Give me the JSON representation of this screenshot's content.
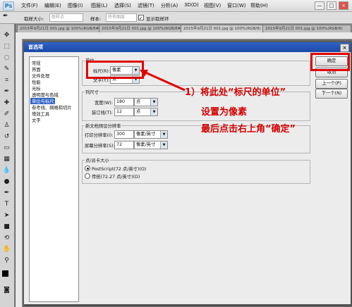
{
  "menubar": {
    "logo": "Ps",
    "items": [
      "文件(F)",
      "编辑(E)",
      "图像(I)",
      "图层(L)",
      "选择(S)",
      "滤镜(T)",
      "分析(A)",
      "3D(D)",
      "视图(V)",
      "窗口(W)",
      "帮助(H)"
    ],
    "window_controls": [
      "—",
      "□",
      "×"
    ]
  },
  "options_bar": {
    "sample_size_label": "取样大小:",
    "sample_size_value": "取样点",
    "sample_label": "样本:",
    "sample_value": "所有图层",
    "show_ring_label": "显示取样环"
  },
  "doc_tabs": [
    "2015年9月21日 001.jpg @ 100%(RGB/8#)",
    "2015年9月21日 001.jpg @ 100%(RGB/8#)",
    "2015年9月21日 001.jpg @ 100%(RGB/8)",
    "2015年9月21日 001.jpg @ 100%(RGB/8)"
  ],
  "dialog": {
    "title": "首选项",
    "close": "×",
    "categories": [
      "常规",
      "界面",
      "文件处理",
      "性能",
      "光标",
      "透明度与色域",
      "单位与标尺",
      "参考线、网格和切片",
      "增效工具",
      "文字"
    ],
    "selected_category": "单位与标尺",
    "units_group": {
      "legend": "单位",
      "ruler_label": "标尺(R):",
      "ruler_value": "像素",
      "type_label": "文字(Y):",
      "type_value": "点"
    },
    "column_group": {
      "legend": "列尺寸",
      "width_label": "宽度(W):",
      "width_value": "180",
      "width_unit": "点",
      "gutter_label": "装订线(T):",
      "gutter_value": "12",
      "gutter_unit": "点"
    },
    "resolution_group": {
      "legend": "新文档预设分辨率",
      "print_label": "打印分辨率(I):",
      "print_value": "300",
      "print_unit": "像素/英寸",
      "screen_label": "屏幕分辨率(S):",
      "screen_value": "72",
      "screen_unit": "像素/英寸"
    },
    "point_group": {
      "legend": "点/派卡大小",
      "option1": "PostScript(72 点/英寸)(O)",
      "option2": "传统(72.27 点/英寸)(D)",
      "selected": "PostScript(72 点/英寸)(O)"
    },
    "buttons": {
      "ok": "确定",
      "cancel": "取消",
      "prev": "上一个(P)",
      "next": "下一个(N)"
    }
  },
  "annotation": {
    "line1": "1）将此处“标尺的单位”",
    "line2": "设置为像素",
    "line3": "最后点击右上角“确定”",
    "color": "#e00000"
  }
}
